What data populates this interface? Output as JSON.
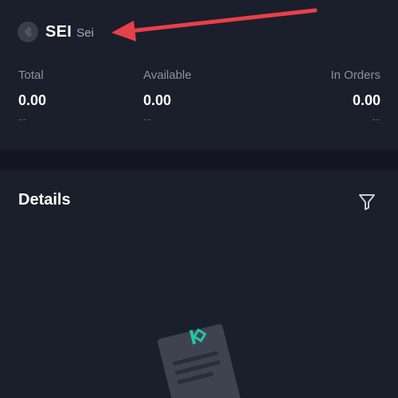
{
  "coin": {
    "symbol": "SEI",
    "name": "Sei",
    "icon": "coin-logo-icon"
  },
  "balances": {
    "total": {
      "label": "Total",
      "value": "0.00",
      "fiat": "--"
    },
    "available": {
      "label": "Available",
      "value": "0.00",
      "fiat": "--"
    },
    "in_orders": {
      "label": "In Orders",
      "value": "0.00",
      "fiat": "--"
    }
  },
  "details": {
    "title": "Details",
    "filter_icon": "filter-icon",
    "empty_icon": "empty-document-icon"
  },
  "colors": {
    "background": "#1b1f2b",
    "divider": "#141721",
    "accent": "#23c7a1",
    "annotation_arrow": "#e8404a"
  }
}
